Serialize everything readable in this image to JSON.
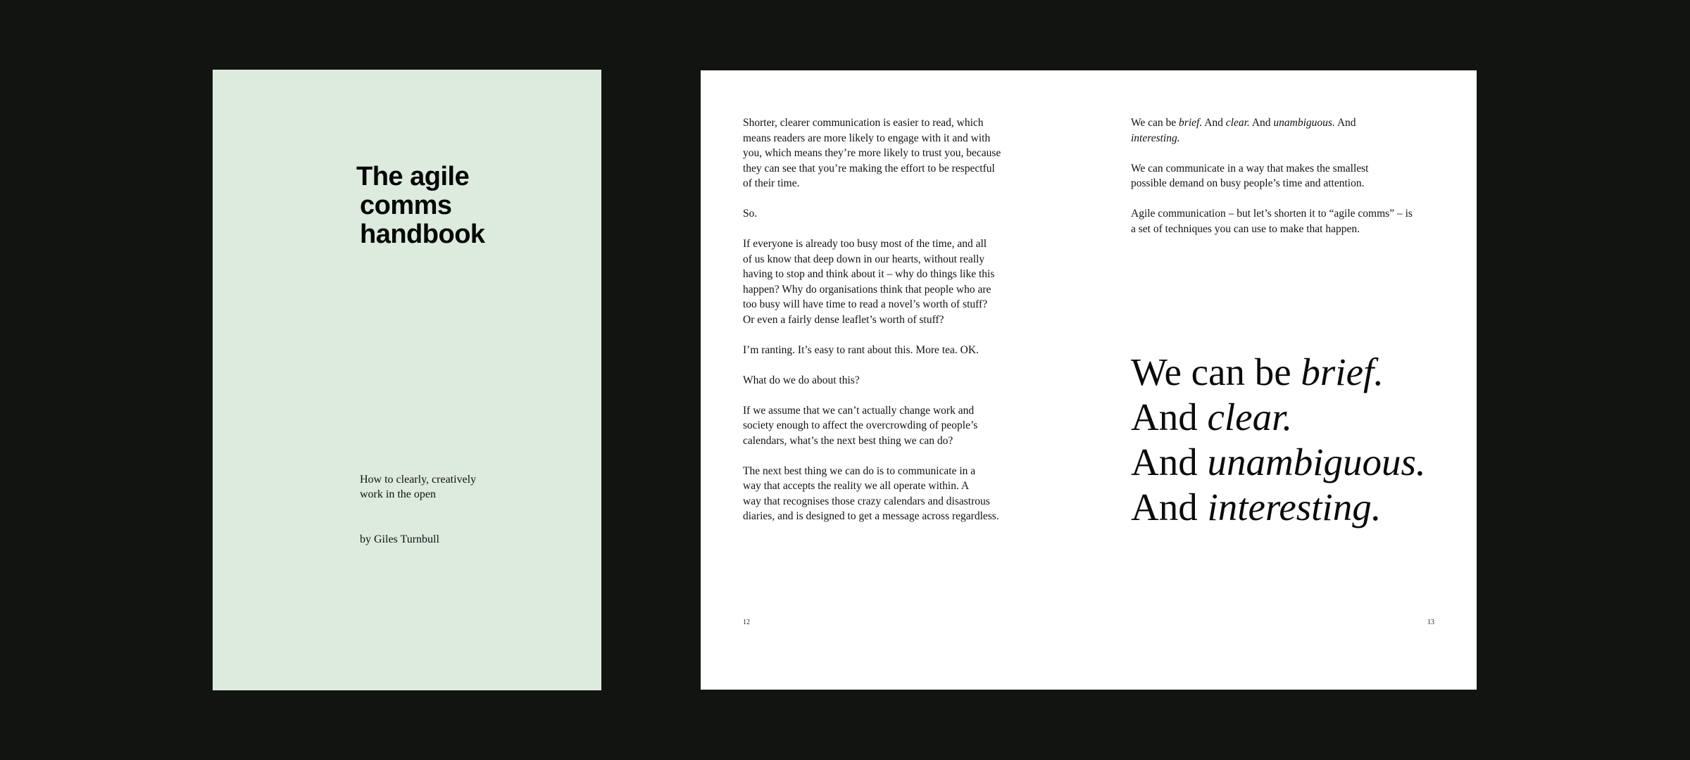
{
  "cover": {
    "title_lines": [
      "The agile",
      "comms",
      "handbook"
    ],
    "subtitle_lines": [
      "How to clearly, creatively",
      "work in the open"
    ],
    "author": "by Giles Turnbull",
    "background_color": "#dcebde"
  },
  "spread": {
    "left_page": {
      "paragraphs": [
        [
          "Shorter, clearer communication is easier to read, which",
          "means readers are more likely to engage with it and with",
          "you, which means they’re more likely to trust you, because",
          "they can see that you’re making the effort to be respectful",
          "of their time."
        ],
        [
          "So."
        ],
        [
          "If everyone is already too busy most of the time, and all",
          "of us know that deep down in our hearts, without really",
          "having to stop and think about it – why do things like this",
          "happen? Why do organisations think that people who are",
          "too busy will have time to read a novel’s worth of stuff?",
          "Or even a fairly dense leaflet’s worth of stuff?"
        ],
        [
          "I’m ranting. It’s easy to rant about this. More tea. OK."
        ],
        [
          "What do we do about this?"
        ],
        [
          "If we assume that we can’t actually change work and",
          "society enough to affect the overcrowding of people’s",
          "calendars, what’s the next best thing we can do?"
        ],
        [
          "The next best thing we can do is to communicate in a",
          "way that accepts the reality we all operate within. A",
          "way that recognises those crazy calendars and disastrous",
          "diaries, and is designed to get a message across regardless."
        ]
      ],
      "page_number": "12"
    },
    "right_page": {
      "intro": {
        "p1_a": "We can be ",
        "p1_brief": "brief.",
        "p1_b": " And ",
        "p1_clear": "clear.",
        "p1_c": " And ",
        "p1_unambiguous": "unambiguous.",
        "p1_d": " And",
        "p1_interesting": "interesting."
      },
      "paragraphs": [
        [
          "We can communicate in a way that makes the smallest",
          "possible demand on busy people’s time and attention."
        ],
        [
          "Agile communication – but let’s shorten it to “agile comms” – is",
          "a set of techniques you can use to make that happen."
        ]
      ],
      "quote": {
        "l1_plain": "We can be ",
        "l1_em": "brief.",
        "l2_plain": "And ",
        "l2_em": "clear.",
        "l3_plain": "And ",
        "l3_em": "unambiguous.",
        "l4_plain": "And ",
        "l4_em": "interesting."
      },
      "page_number": "13"
    }
  }
}
